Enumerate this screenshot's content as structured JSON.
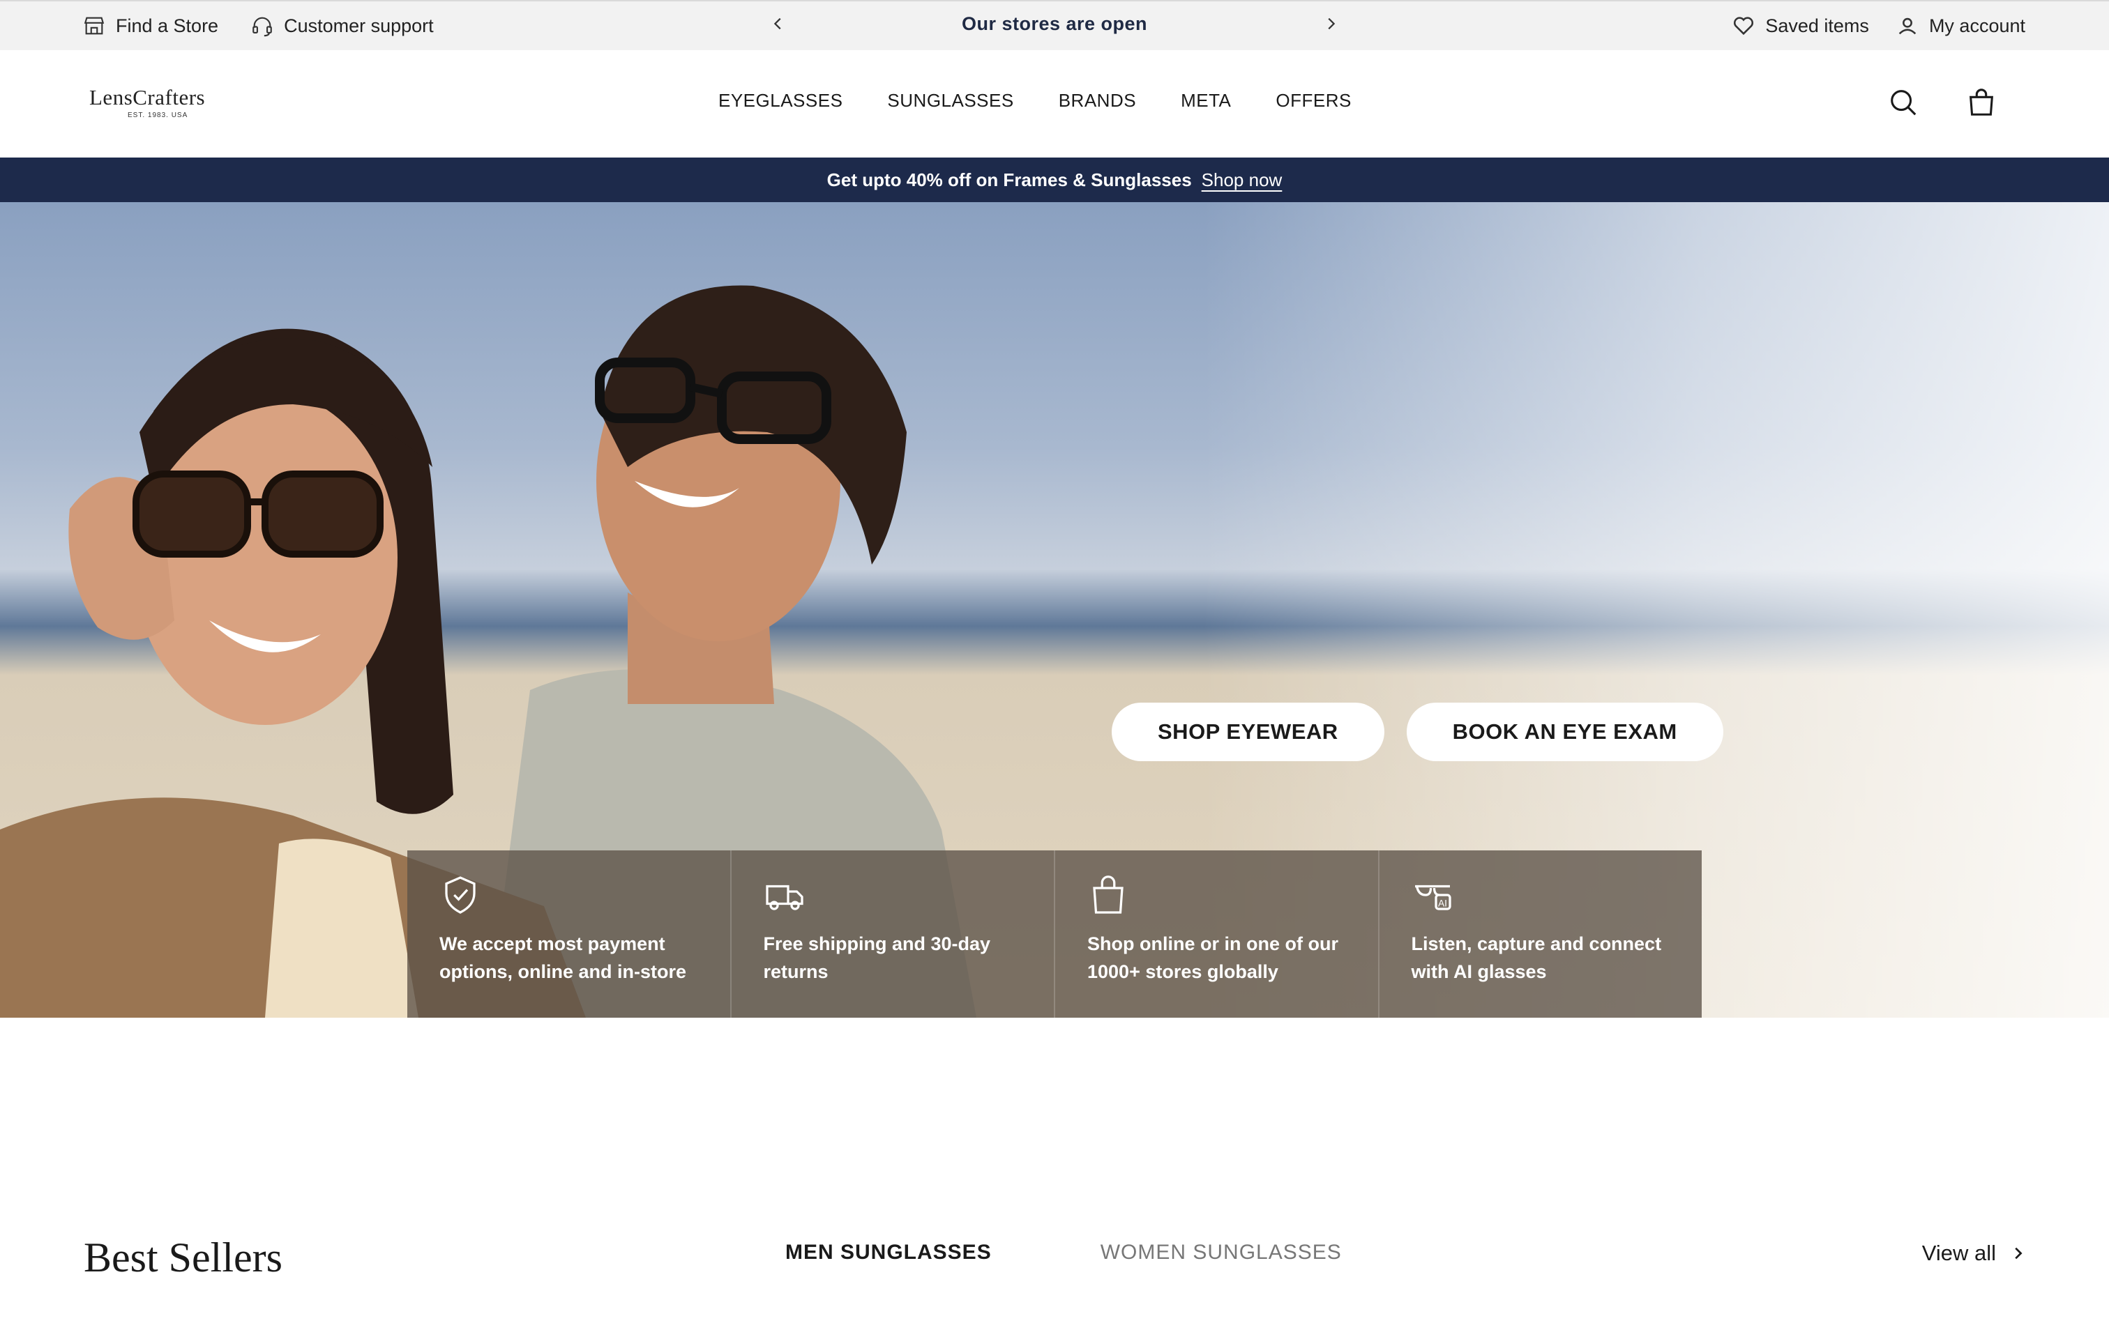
{
  "utility_bar": {
    "find_store": "Find a Store",
    "customer_support": "Customer support",
    "announcement": "Our stores are open",
    "saved_items": "Saved items",
    "my_account": "My account"
  },
  "header": {
    "logo_text": "LensCrafters",
    "logo_sub": "EST. 1983. USA",
    "nav": [
      "EYEGLASSES",
      "SUNGLASSES",
      "BRANDS",
      "META",
      "OFFERS"
    ]
  },
  "promo": {
    "text": "Get upto 40% off on Frames & Sunglasses",
    "link": "Shop now",
    "bg_color": "#1d2a4b"
  },
  "hero": {
    "buttons": [
      "SHOP EYEWEAR",
      "BOOK AN EYE EXAM"
    ],
    "benefits": [
      {
        "icon": "shield-check-icon",
        "text": "We accept most payment options, online and in-store"
      },
      {
        "icon": "truck-icon",
        "text": "Free shipping and 30-day returns"
      },
      {
        "icon": "shopping-bag-icon",
        "text": "Shop online or in one of our 1000+ stores globally"
      },
      {
        "icon": "ai-glasses-icon",
        "text": "Listen, capture and connect with AI glasses"
      }
    ]
  },
  "best_sellers": {
    "title": "Best Sellers",
    "tabs": [
      "MEN SUNGLASSES",
      "WOMEN SUNGLASSES"
    ],
    "active_tab": "MEN SUNGLASSES",
    "view_all": "View all"
  }
}
